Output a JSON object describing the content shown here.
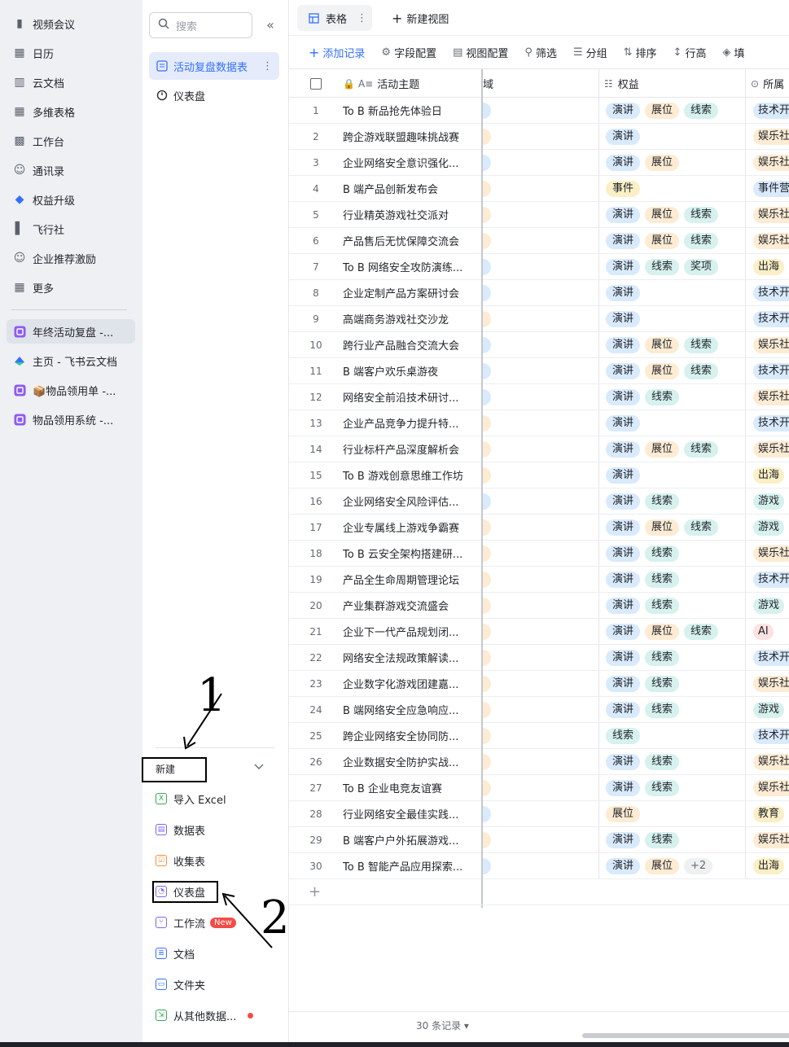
{
  "app_nav": [
    {
      "label": "视频会议",
      "icon": "video-icon"
    },
    {
      "label": "日历",
      "icon": "calendar-icon"
    },
    {
      "label": "云文档",
      "icon": "doc-icon"
    },
    {
      "label": "多维表格",
      "icon": "base-icon"
    },
    {
      "label": "工作台",
      "icon": "workplace-icon"
    },
    {
      "label": "通讯录",
      "icon": "contacts-icon"
    },
    {
      "label": "权益升级",
      "icon": "diamond-icon"
    },
    {
      "label": "飞行社",
      "icon": "flag-icon"
    },
    {
      "label": "企业推荐激励",
      "icon": "referral-icon"
    },
    {
      "label": "更多",
      "icon": "more-apps-icon"
    }
  ],
  "recent_docs": [
    {
      "label": "年终活动复盘 -...",
      "active": true
    },
    {
      "label": "主页 - 飞书云文档",
      "active": false
    },
    {
      "label": "📦物品领用单 -...",
      "active": false
    },
    {
      "label": "物品领用系统 -...",
      "active": false
    }
  ],
  "panel": {
    "search_placeholder": "搜索",
    "items": [
      {
        "label": "活动复盘数据表",
        "active": true
      },
      {
        "label": "仪表盘",
        "active": false
      }
    ],
    "new_label": "新建",
    "new_items": [
      {
        "label": "导入 Excel",
        "icon": "excel-icon",
        "color": "#34a853"
      },
      {
        "label": "数据表",
        "icon": "table-icon",
        "color": "#7b67ee"
      },
      {
        "label": "收集表",
        "icon": "form-icon",
        "color": "#f0913e"
      },
      {
        "label": "仪表盘",
        "icon": "dashboard-icon",
        "color": "#7b67ee"
      },
      {
        "label": "工作流",
        "icon": "workflow-icon",
        "color": "#7b67ee",
        "badge": "New"
      },
      {
        "label": "文档",
        "icon": "document-icon",
        "color": "#3370ff"
      },
      {
        "label": "文件夹",
        "icon": "folder-icon",
        "color": "#3370ff"
      },
      {
        "label": "从其他数据...",
        "icon": "import-data-icon",
        "color": "#34a853",
        "dot": true
      }
    ]
  },
  "annotations": {
    "one": "1",
    "two": "2"
  },
  "tabs": {
    "table": "表格",
    "new_view": "新建视图"
  },
  "toolbar": {
    "add": "添加记录",
    "fields": "字段配置",
    "view": "视图配置",
    "filter": "筛选",
    "group": "分组",
    "sort": "排序",
    "row_height": "行高",
    "fill": "填"
  },
  "columns": {
    "title": "活动主题",
    "domain": "域",
    "rights": "权益",
    "belong": "所属"
  },
  "rows": [
    {
      "n": "1",
      "title": "To B 新品抢先体验日",
      "d": "blue",
      "rights": [
        "演讲",
        "展位",
        "线索"
      ],
      "belong": "技术开",
      "bc": "blue"
    },
    {
      "n": "2",
      "title": "跨企游戏联盟趣味挑战赛",
      "d": "orange",
      "rights": [
        "演讲"
      ],
      "belong": "娱乐社",
      "bc": "orange"
    },
    {
      "n": "3",
      "title": "企业网络安全意识强化...",
      "d": "blue",
      "rights": [
        "演讲",
        "展位"
      ],
      "belong": "娱乐社",
      "bc": "orange"
    },
    {
      "n": "4",
      "title": "B 端产品创新发布会",
      "d": "orange",
      "rights": [
        "事件"
      ],
      "belong": "事件营",
      "bc": "blue"
    },
    {
      "n": "5",
      "title": "行业精英游戏社交派对",
      "d": "orange",
      "rights": [
        "演讲",
        "展位",
        "线索"
      ],
      "belong": "娱乐社",
      "bc": "orange"
    },
    {
      "n": "6",
      "title": "产品售后无忧保障交流会",
      "d": "orange",
      "rights": [
        "演讲",
        "展位",
        "线索"
      ],
      "belong": "娱乐社",
      "bc": "orange"
    },
    {
      "n": "7",
      "title": "To B 网络安全攻防演练...",
      "d": "blue",
      "rights": [
        "演讲",
        "线索",
        "奖项"
      ],
      "belong": "出海",
      "bc": "yellow"
    },
    {
      "n": "8",
      "title": "企业定制产品方案研讨会",
      "d": "blue",
      "rights": [
        "演讲"
      ],
      "belong": "技术开",
      "bc": "blue"
    },
    {
      "n": "9",
      "title": "高端商务游戏社交沙龙",
      "d": "orange",
      "rights": [
        "演讲"
      ],
      "belong": "技术开",
      "bc": "blue"
    },
    {
      "n": "10",
      "title": "跨行业产品融合交流大会",
      "d": "blue",
      "rights": [
        "演讲",
        "展位",
        "线索"
      ],
      "belong": "娱乐社",
      "bc": "orange"
    },
    {
      "n": "11",
      "title": "B 端客户欢乐桌游夜",
      "d": "blue",
      "rights": [
        "演讲",
        "展位",
        "线索"
      ],
      "belong": "技术开",
      "bc": "blue"
    },
    {
      "n": "12",
      "title": "网络安全前沿技术研讨...",
      "d": "blue",
      "rights": [
        "演讲",
        "线索"
      ],
      "belong": "娱乐社",
      "bc": "orange"
    },
    {
      "n": "13",
      "title": "企业产品竞争力提升特...",
      "d": "orange",
      "rights": [
        "演讲"
      ],
      "belong": "技术开",
      "bc": "blue"
    },
    {
      "n": "14",
      "title": "行业标杆产品深度解析会",
      "d": "orange",
      "rights": [
        "演讲",
        "展位",
        "线索"
      ],
      "belong": "娱乐社",
      "bc": "orange"
    },
    {
      "n": "15",
      "title": "To B 游戏创意思维工作坊",
      "d": "orange",
      "rights": [
        "演讲"
      ],
      "belong": "出海",
      "bc": "yellow"
    },
    {
      "n": "16",
      "title": "企业网络安全风险评估...",
      "d": "blue",
      "rights": [
        "演讲",
        "线索"
      ],
      "belong": "游戏",
      "bc": "teal"
    },
    {
      "n": "17",
      "title": "企业专属线上游戏争霸赛",
      "d": "orange",
      "rights": [
        "演讲",
        "展位",
        "线索"
      ],
      "belong": "游戏",
      "bc": "teal"
    },
    {
      "n": "18",
      "title": "To B 云安全架构搭建研...",
      "d": "orange",
      "rights": [
        "演讲",
        "线索"
      ],
      "belong": "娱乐社",
      "bc": "orange"
    },
    {
      "n": "19",
      "title": "产品全生命周期管理论坛",
      "d": "orange",
      "rights": [
        "演讲",
        "线索"
      ],
      "belong": "技术开",
      "bc": "blue"
    },
    {
      "n": "20",
      "title": "产业集群游戏交流盛会",
      "d": "orange",
      "rights": [
        "演讲",
        "线索"
      ],
      "belong": "游戏",
      "bc": "teal"
    },
    {
      "n": "21",
      "title": "企业下一代产品规划闭...",
      "d": "orange",
      "rights": [
        "演讲",
        "展位",
        "线索"
      ],
      "belong": "AI",
      "bc": "red"
    },
    {
      "n": "22",
      "title": "网络安全法规政策解读...",
      "d": "orange",
      "rights": [
        "演讲",
        "线索"
      ],
      "belong": "技术开",
      "bc": "blue"
    },
    {
      "n": "23",
      "title": "企业数字化游戏团建嘉...",
      "d": "orange",
      "rights": [
        "演讲",
        "线索"
      ],
      "belong": "娱乐社",
      "bc": "orange"
    },
    {
      "n": "24",
      "title": "B 端网络安全应急响应...",
      "d": "orange",
      "rights": [
        "演讲",
        "线索"
      ],
      "belong": "游戏",
      "bc": "teal"
    },
    {
      "n": "25",
      "title": "跨企业网络安全协同防...",
      "d": "orange",
      "rights": [
        "线索"
      ],
      "belong": "技术开",
      "bc": "blue"
    },
    {
      "n": "26",
      "title": "企业数据安全防护实战...",
      "d": "orange",
      "rights": [
        "演讲",
        "线索"
      ],
      "belong": "娱乐社",
      "bc": "orange"
    },
    {
      "n": "27",
      "title": "To B 企业电竞友谊赛",
      "d": "orange",
      "rights": [
        "演讲",
        "线索"
      ],
      "belong": "娱乐社",
      "bc": "orange"
    },
    {
      "n": "28",
      "title": "行业网络安全最佳实践...",
      "d": "blue",
      "rights": [
        "展位"
      ],
      "belong": "教育",
      "bc": "yellow"
    },
    {
      "n": "29",
      "title": "B 端客户户外拓展游戏...",
      "d": "orange",
      "rights": [
        "演讲",
        "线索"
      ],
      "belong": "娱乐社",
      "bc": "orange"
    },
    {
      "n": "30",
      "title": "To B 智能产品应用探索...",
      "d": "blue",
      "rights": [
        "演讲",
        "展位",
        "+2"
      ],
      "belong": "出海",
      "bc": "yellow"
    }
  ],
  "footer": {
    "record_count": "30 条记录 ▾"
  },
  "colors": {
    "accent": "#3370ff"
  }
}
